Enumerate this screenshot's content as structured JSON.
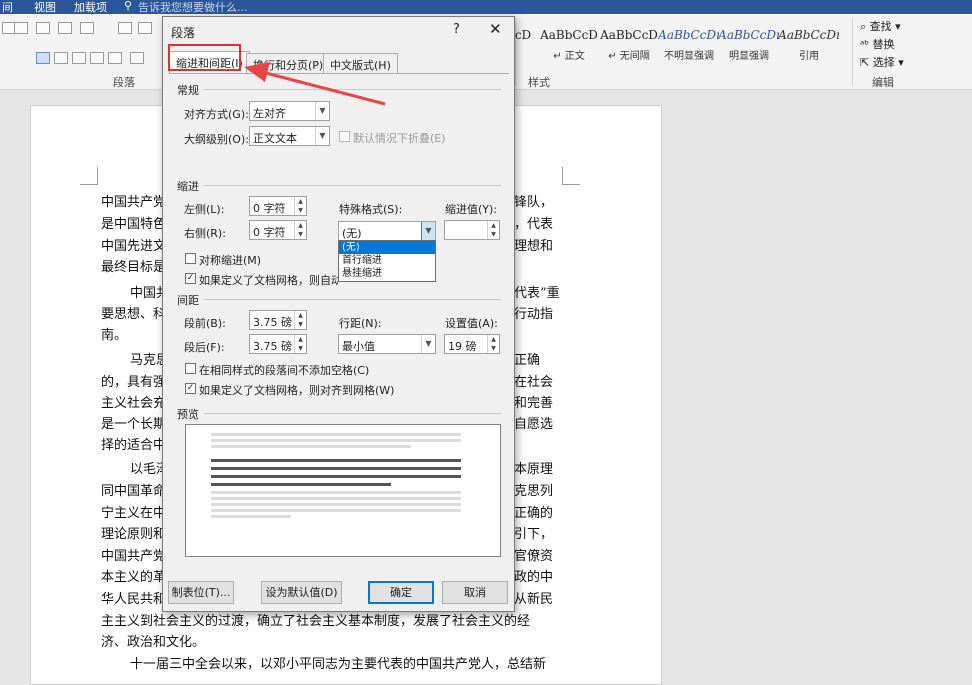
{
  "titlebar": {
    "items": [
      "间",
      "视图",
      "加载项",
      "告诉我您想要做什么..."
    ]
  },
  "ribbon": {
    "group_paragraph": "段落",
    "group_styles": "样式",
    "group_edit": "编辑",
    "styles": [
      {
        "sample": "AaBbCcD",
        "name": "↵ 正文"
      },
      {
        "sample": "AaBbCcD",
        "name": "↵ 无间隔"
      },
      {
        "sample": "AaBbCcDı",
        "name": "不明显强调"
      },
      {
        "sample": "AaBbCcDı",
        "name": "明显强调"
      },
      {
        "sample": "AaBbCcDı",
        "name": "引用"
      }
    ],
    "find": "查找",
    "replace": "替换",
    "select": "选择"
  },
  "doc": {
    "lines": [
      {
        "left": "中国共产党",
        "right": "锋队，"
      },
      {
        "left": "是中国特色",
        "right": "，代表"
      },
      {
        "left": "中国先进文",
        "right": "理想和"
      },
      {
        "left": "最终目标是",
        "right": ""
      },
      {
        "left": "中国共",
        "right": "代表”重"
      },
      {
        "left": "要思想、科",
        "right": "行动指"
      },
      {
        "left": "南。",
        "right": ""
      },
      {
        "left": "马克思",
        "right": "正确"
      },
      {
        "left": "的，具有强",
        "right": "在社会"
      },
      {
        "left": "主义社会充",
        "right": "和完善"
      },
      {
        "left": "是一个长期",
        "right": "自愿选"
      },
      {
        "left": "择的适合中",
        "right": ""
      },
      {
        "left": "以毛泽",
        "right": "本原理"
      },
      {
        "left": "同中国革命",
        "right": "克思列"
      },
      {
        "left": "宁主义在中",
        "right": "正确的"
      },
      {
        "left": "理论原则和",
        "right": "引下，"
      },
      {
        "left": "中国共产党",
        "right": "官僚资"
      },
      {
        "left": "本主义的革",
        "right": "政的中"
      },
      {
        "left": "华人民共和",
        "right": "从新民"
      }
    ],
    "full_line_1": "主主义到社会主义的过渡，确立了社会主义基本制度，发展了社会主义的经",
    "full_line_2": "济、政治和文化。",
    "full_line_3": "十一届三中全会以来，以邓小平同志为主要代表的中国共产党人，总结新"
  },
  "dialog": {
    "title": "段落",
    "help": "?",
    "close": "✕",
    "tabs": [
      "缩进和间距(I)",
      "换行和分页(P)",
      "中文版式(H)"
    ],
    "general": {
      "section": "常规",
      "alignment_label": "对齐方式(G):",
      "alignment_value": "左对齐",
      "outline_label": "大纲级别(O):",
      "outline_value": "正文文本",
      "collapse_label": "默认情况下折叠(E)"
    },
    "indent": {
      "section": "缩进",
      "left_label": "左侧(L):",
      "left_value": "0 字符",
      "right_label": "右侧(R):",
      "right_value": "0 字符",
      "special_label": "特殊格式(S):",
      "special_value": "(无)",
      "special_options": [
        "(无)",
        "首行缩进",
        "悬挂缩进"
      ],
      "by_label": "缩进值(Y):",
      "by_value": "",
      "mirror_label": "对称缩进(M)",
      "grid_label": "如果定义了文档网格，则自动调整右缩进(D)"
    },
    "spacing": {
      "section": "间距",
      "before_label": "段前(B):",
      "before_value": "3.75 磅",
      "after_label": "段后(F):",
      "after_value": "3.75 磅",
      "line_label": "行距(N):",
      "line_value": "最小值",
      "at_label": "设置值(A):",
      "at_value": "19 磅",
      "no_space_label": "在相同样式的段落间不添加空格(C)",
      "snap_label": "如果定义了文档网格，则对齐到网格(W)"
    },
    "preview": {
      "section": "预览"
    },
    "buttons": {
      "tabs": "制表位(T)...",
      "default": "设为默认值(D)",
      "ok": "确定",
      "cancel": "取消"
    }
  },
  "colors": {
    "accent": "#0078d7",
    "highlight": "#e03030",
    "titlebar": "#2b579a"
  }
}
